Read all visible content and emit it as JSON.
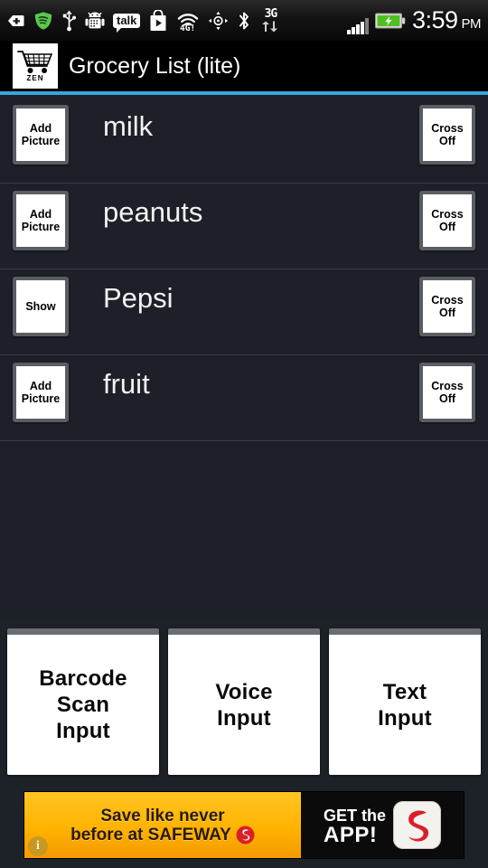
{
  "statusbar": {
    "icons": [
      {
        "name": "back-tag-icon",
        "glyph": "arrow-tag"
      },
      {
        "name": "spotify-icon",
        "glyph": "spotify"
      },
      {
        "name": "usb-icon",
        "glyph": "usb"
      },
      {
        "name": "android-sync-icon",
        "glyph": "android"
      },
      {
        "name": "google-talk-icon",
        "label": "talk"
      },
      {
        "name": "play-store-icon",
        "glyph": "play-bag"
      },
      {
        "name": "wifi-4g-icon",
        "label": "4G!"
      },
      {
        "name": "gps-location-icon",
        "glyph": "gps"
      },
      {
        "name": "bluetooth-icon",
        "glyph": "bluetooth"
      },
      {
        "name": "network-3g-icon",
        "label": "3G"
      }
    ],
    "network_label": "3G",
    "signal_bars": 4,
    "signal_bars_total": 5,
    "battery_state": "charging",
    "time": "3:59",
    "ampm": "PM"
  },
  "titlebar": {
    "logo_caption": "ZEN",
    "title": "Grocery List (lite)",
    "accent_color": "#3ba4db"
  },
  "list": {
    "items": [
      {
        "name": "milk",
        "left_button": "Add\nPicture",
        "right_button": "Cross\nOff"
      },
      {
        "name": "peanuts",
        "left_button": "Add\nPicture",
        "right_button": "Cross\nOff"
      },
      {
        "name": "Pepsi",
        "left_button": "Show",
        "right_button": "Cross\nOff"
      },
      {
        "name": "fruit",
        "left_button": "Add\nPicture",
        "right_button": "Cross\nOff"
      }
    ]
  },
  "actions": [
    {
      "name": "barcode-scan-input",
      "label": "Barcode\nScan\nInput"
    },
    {
      "name": "voice-input",
      "label": "Voice\nInput"
    },
    {
      "name": "text-input",
      "label": "Text\nInput"
    }
  ],
  "ad": {
    "line1": "Save like never",
    "line2": "before at SAFEWAY",
    "cta_line1": "GET the",
    "cta_line2": "APP!",
    "info_badge": "i",
    "bg_color": "#ffb300",
    "cta_bg_color": "#0b0b0b",
    "logo_color": "#d9202a"
  }
}
